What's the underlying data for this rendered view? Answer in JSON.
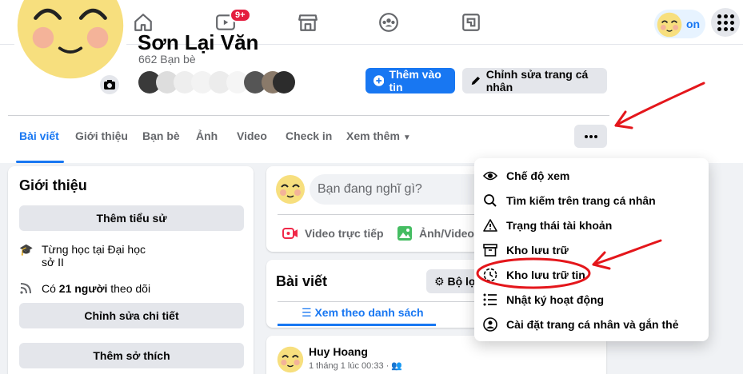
{
  "topnav": {
    "icons": [
      "home-icon",
      "watch-icon",
      "marketplace-icon",
      "groups-icon",
      "gaming-icon"
    ],
    "watch_badge": "9+",
    "profile_chip_label": "on",
    "colors": {
      "accent": "#1877f2",
      "badge": "#e41e3f"
    }
  },
  "profile": {
    "name": "Sơn Lại Văn",
    "friends_count": "662 Bạn bè",
    "add_story_label": "Thêm vào tin",
    "edit_profile_label": "Chỉnh sửa trang cá nhân"
  },
  "tabs": [
    {
      "label": "Bài viết"
    },
    {
      "label": "Giới thiệu"
    },
    {
      "label": "Bạn bè"
    },
    {
      "label": "Ảnh"
    },
    {
      "label": "Video"
    },
    {
      "label": "Check in"
    },
    {
      "label": "Xem thêm"
    }
  ],
  "intro": {
    "title": "Giới thiệu",
    "add_bio_label": "Thêm tiểu sử",
    "education": "Từng học tại Đại học",
    "education_line2": "sở II",
    "followers": "Có",
    "followers_count": "21 người",
    "followers_suffix": "theo dõi",
    "edit_details_label": "Chỉnh sửa chi tiết",
    "add_hobbies_label": "Thêm sở thích"
  },
  "composer": {
    "placeholder": "Bạn đang nghĩ gì?",
    "live_video_label": "Video trực tiếp",
    "photo_video_label": "Ảnh/Video"
  },
  "posts": {
    "title": "Bài viết",
    "filter_label": "Bộ lọc",
    "list_view_label": "Xem theo danh sách",
    "first_post": {
      "author": "Huy Hoang",
      "time": "1 tháng 1 lúc 00:33 ·"
    }
  },
  "menu": {
    "items": [
      {
        "label": "Chế độ xem",
        "icon": "eye-icon"
      },
      {
        "label": "Tìm kiếm trên trang cá nhân",
        "icon": "search-icon"
      },
      {
        "label": "Trạng thái tài khoản",
        "icon": "warning-icon"
      },
      {
        "label": "Kho lưu trữ",
        "icon": "archive-icon"
      },
      {
        "label": "Kho lưu trữ tin",
        "icon": "story-archive-icon"
      },
      {
        "label": "Nhật ký hoạt động",
        "icon": "list-icon"
      },
      {
        "label": "Cài đặt trang cá nhân và gắn thẻ",
        "icon": "profile-settings-icon"
      }
    ]
  }
}
